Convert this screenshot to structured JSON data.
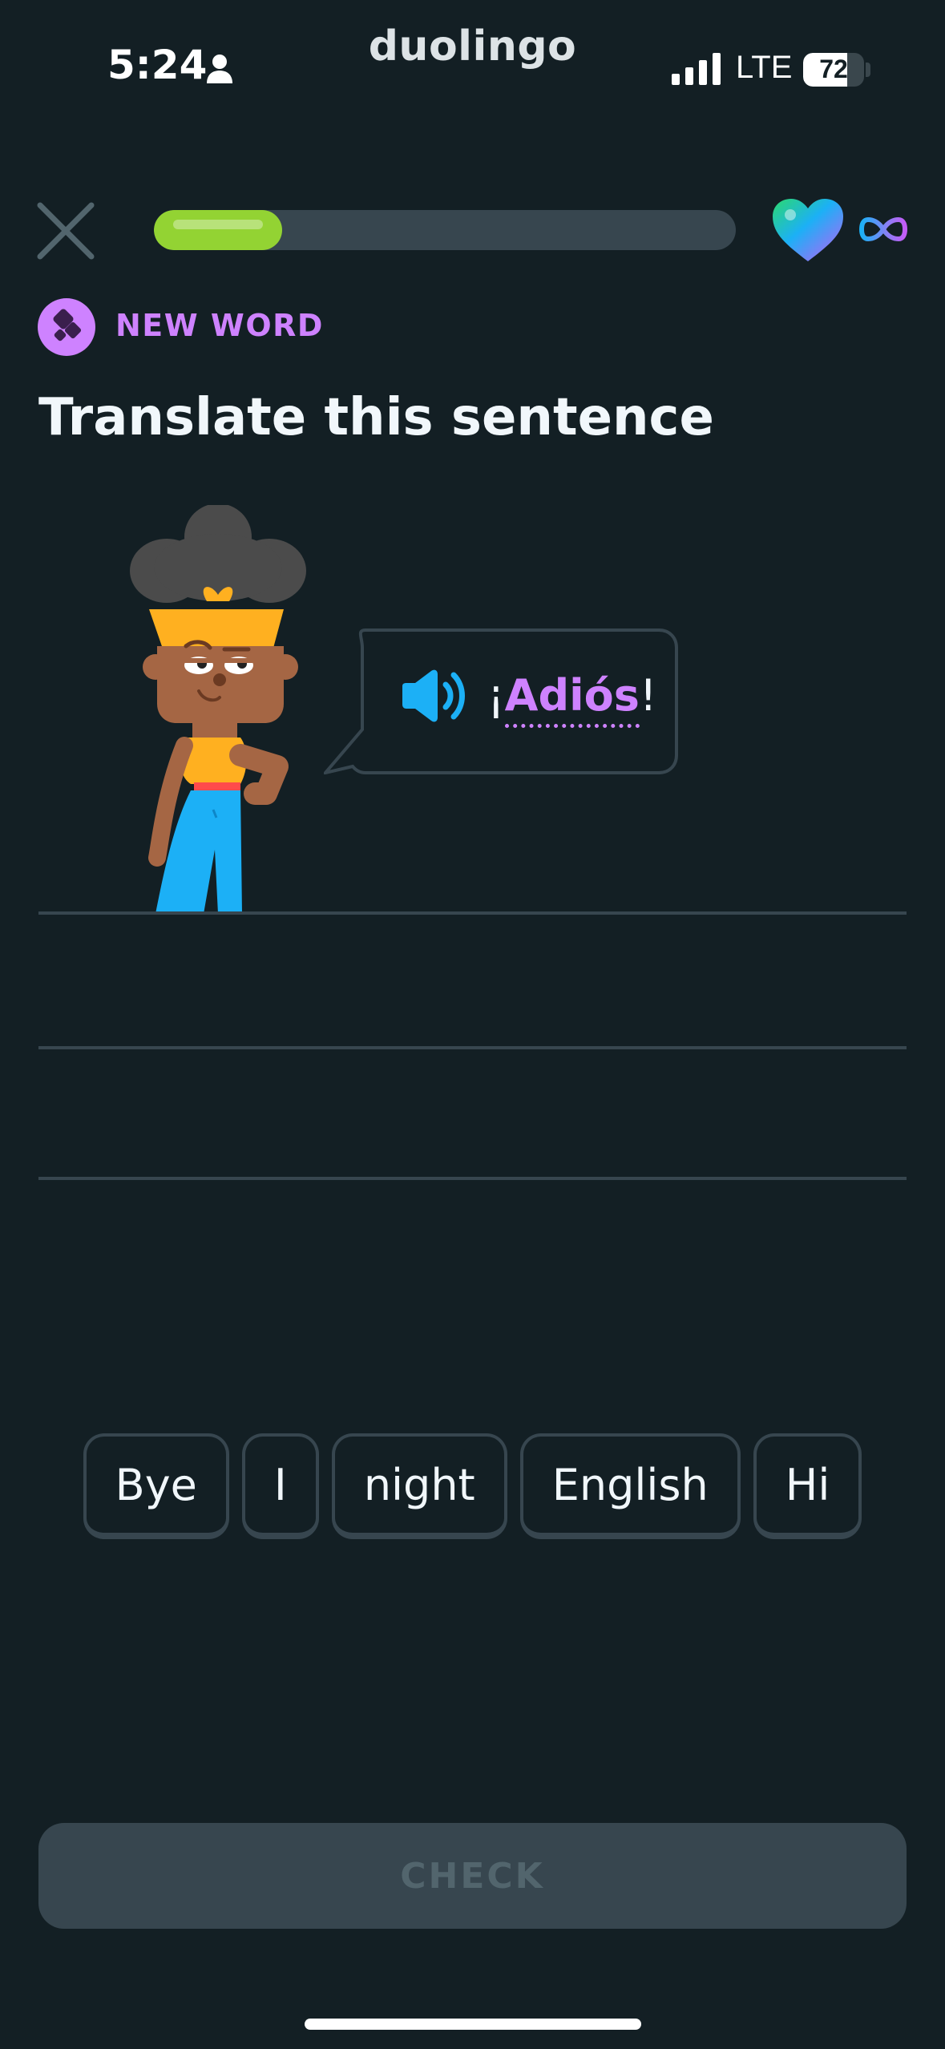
{
  "status_bar": {
    "time": "5:24",
    "network": "LTE",
    "battery": "72",
    "battery_level": 0.72,
    "icons": [
      "person-icon",
      "signal-icon",
      "battery-icon"
    ]
  },
  "brand": "duolingo",
  "lesson": {
    "progress": 0.22,
    "hearts": "∞",
    "icons": [
      "close-icon",
      "heart-icon",
      "infinity-icon"
    ]
  },
  "badge": {
    "label": "NEW WORD",
    "icon": "new-word-icon",
    "color": "#ce82ff"
  },
  "prompt": {
    "title": "Translate this sentence",
    "phrase_prefix": "¡",
    "phrase_word": "Adiós",
    "phrase_suffix": "!",
    "icon": "speaker-icon"
  },
  "word_bank": [
    "Bye",
    "I",
    "night",
    "English",
    "Hi"
  ],
  "check_button": "CHECK",
  "colors": {
    "background": "#131f24",
    "accent_purple": "#ce82ff",
    "progress_green": "#93d333",
    "speaker_blue": "#1cb0f6",
    "border": "#37464f"
  }
}
